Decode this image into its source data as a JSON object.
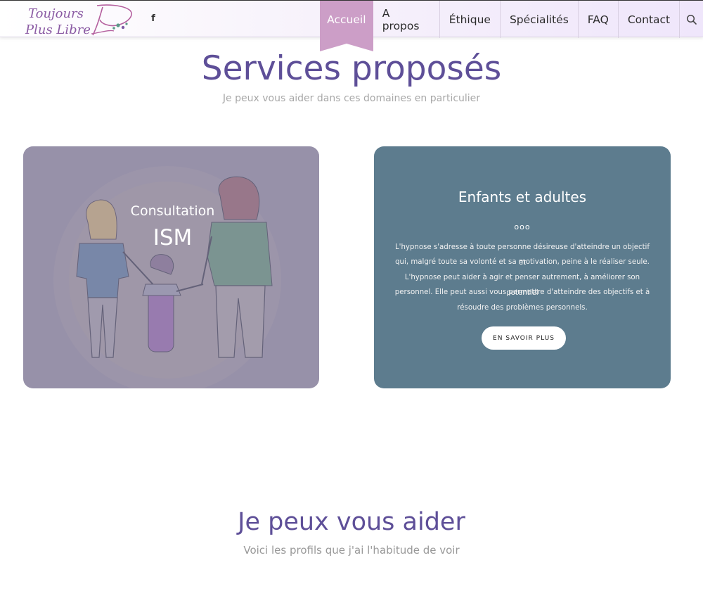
{
  "header": {
    "logo_line1": "Toujours",
    "logo_line2": "Plus Libre",
    "facebook_icon": "facebook-icon",
    "nav": [
      {
        "label": "Accueil",
        "active": true
      },
      {
        "label": "A propos"
      },
      {
        "label": "Éthique"
      },
      {
        "label": "Spécialités"
      },
      {
        "label": "FAQ"
      },
      {
        "label": "Contact"
      }
    ],
    "search_icon": "search-icon"
  },
  "services": {
    "title": "Services proposés",
    "subtitle": "Je peux vous aider dans ces domaines en particulier"
  },
  "card_left": {
    "label": "Consultation",
    "big_label": "ISM"
  },
  "card_right": {
    "title": "Enfants et adultes",
    "dots": "ooo",
    "lines": [
      "L'hypnose s'adresse à toute personne désireuse d'atteindre un objectif et",
      "qui, malgré toute sa volonté et sa motivation, peine à le réaliser seule.",
      "L'hypnose peut aider à agir et penser autrement, à améliorer son potentiel",
      "personnel. Elle peut aussi vous permettre d'atteindre des objectifs et à",
      "résoudre des problèmes personnels."
    ],
    "button": "EN SAVOIR PLUS"
  },
  "help": {
    "title": "Je peux vous aider",
    "subtitle": "Voici les profils que j'ai l'habitude de voir"
  },
  "colors": {
    "accent_purple": "#5e4f98",
    "nav_active": "#cc9ec7",
    "card_left_bg": "#9a95a9",
    "card_right_bg": "#5d7c8e"
  }
}
